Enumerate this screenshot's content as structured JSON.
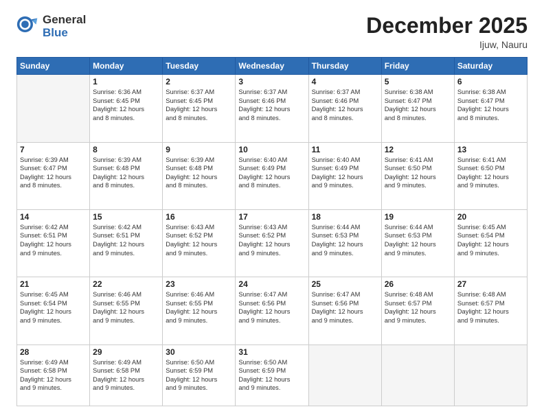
{
  "logo": {
    "general": "General",
    "blue": "Blue"
  },
  "title": "December 2025",
  "location": "Ijuw, Nauru",
  "weekdays": [
    "Sunday",
    "Monday",
    "Tuesday",
    "Wednesday",
    "Thursday",
    "Friday",
    "Saturday"
  ],
  "weeks": [
    [
      {
        "day": "",
        "info": ""
      },
      {
        "day": "1",
        "info": "Sunrise: 6:36 AM\nSunset: 6:45 PM\nDaylight: 12 hours\nand 8 minutes."
      },
      {
        "day": "2",
        "info": "Sunrise: 6:37 AM\nSunset: 6:45 PM\nDaylight: 12 hours\nand 8 minutes."
      },
      {
        "day": "3",
        "info": "Sunrise: 6:37 AM\nSunset: 6:46 PM\nDaylight: 12 hours\nand 8 minutes."
      },
      {
        "day": "4",
        "info": "Sunrise: 6:37 AM\nSunset: 6:46 PM\nDaylight: 12 hours\nand 8 minutes."
      },
      {
        "day": "5",
        "info": "Sunrise: 6:38 AM\nSunset: 6:47 PM\nDaylight: 12 hours\nand 8 minutes."
      },
      {
        "day": "6",
        "info": "Sunrise: 6:38 AM\nSunset: 6:47 PM\nDaylight: 12 hours\nand 8 minutes."
      }
    ],
    [
      {
        "day": "7",
        "info": "Sunrise: 6:39 AM\nSunset: 6:47 PM\nDaylight: 12 hours\nand 8 minutes."
      },
      {
        "day": "8",
        "info": "Sunrise: 6:39 AM\nSunset: 6:48 PM\nDaylight: 12 hours\nand 8 minutes."
      },
      {
        "day": "9",
        "info": "Sunrise: 6:39 AM\nSunset: 6:48 PM\nDaylight: 12 hours\nand 8 minutes."
      },
      {
        "day": "10",
        "info": "Sunrise: 6:40 AM\nSunset: 6:49 PM\nDaylight: 12 hours\nand 8 minutes."
      },
      {
        "day": "11",
        "info": "Sunrise: 6:40 AM\nSunset: 6:49 PM\nDaylight: 12 hours\nand 9 minutes."
      },
      {
        "day": "12",
        "info": "Sunrise: 6:41 AM\nSunset: 6:50 PM\nDaylight: 12 hours\nand 9 minutes."
      },
      {
        "day": "13",
        "info": "Sunrise: 6:41 AM\nSunset: 6:50 PM\nDaylight: 12 hours\nand 9 minutes."
      }
    ],
    [
      {
        "day": "14",
        "info": "Sunrise: 6:42 AM\nSunset: 6:51 PM\nDaylight: 12 hours\nand 9 minutes."
      },
      {
        "day": "15",
        "info": "Sunrise: 6:42 AM\nSunset: 6:51 PM\nDaylight: 12 hours\nand 9 minutes."
      },
      {
        "day": "16",
        "info": "Sunrise: 6:43 AM\nSunset: 6:52 PM\nDaylight: 12 hours\nand 9 minutes."
      },
      {
        "day": "17",
        "info": "Sunrise: 6:43 AM\nSunset: 6:52 PM\nDaylight: 12 hours\nand 9 minutes."
      },
      {
        "day": "18",
        "info": "Sunrise: 6:44 AM\nSunset: 6:53 PM\nDaylight: 12 hours\nand 9 minutes."
      },
      {
        "day": "19",
        "info": "Sunrise: 6:44 AM\nSunset: 6:53 PM\nDaylight: 12 hours\nand 9 minutes."
      },
      {
        "day": "20",
        "info": "Sunrise: 6:45 AM\nSunset: 6:54 PM\nDaylight: 12 hours\nand 9 minutes."
      }
    ],
    [
      {
        "day": "21",
        "info": "Sunrise: 6:45 AM\nSunset: 6:54 PM\nDaylight: 12 hours\nand 9 minutes."
      },
      {
        "day": "22",
        "info": "Sunrise: 6:46 AM\nSunset: 6:55 PM\nDaylight: 12 hours\nand 9 minutes."
      },
      {
        "day": "23",
        "info": "Sunrise: 6:46 AM\nSunset: 6:55 PM\nDaylight: 12 hours\nand 9 minutes."
      },
      {
        "day": "24",
        "info": "Sunrise: 6:47 AM\nSunset: 6:56 PM\nDaylight: 12 hours\nand 9 minutes."
      },
      {
        "day": "25",
        "info": "Sunrise: 6:47 AM\nSunset: 6:56 PM\nDaylight: 12 hours\nand 9 minutes."
      },
      {
        "day": "26",
        "info": "Sunrise: 6:48 AM\nSunset: 6:57 PM\nDaylight: 12 hours\nand 9 minutes."
      },
      {
        "day": "27",
        "info": "Sunrise: 6:48 AM\nSunset: 6:57 PM\nDaylight: 12 hours\nand 9 minutes."
      }
    ],
    [
      {
        "day": "28",
        "info": "Sunrise: 6:49 AM\nSunset: 6:58 PM\nDaylight: 12 hours\nand 9 minutes."
      },
      {
        "day": "29",
        "info": "Sunrise: 6:49 AM\nSunset: 6:58 PM\nDaylight: 12 hours\nand 9 minutes."
      },
      {
        "day": "30",
        "info": "Sunrise: 6:50 AM\nSunset: 6:59 PM\nDaylight: 12 hours\nand 9 minutes."
      },
      {
        "day": "31",
        "info": "Sunrise: 6:50 AM\nSunset: 6:59 PM\nDaylight: 12 hours\nand 9 minutes."
      },
      {
        "day": "",
        "info": ""
      },
      {
        "day": "",
        "info": ""
      },
      {
        "day": "",
        "info": ""
      }
    ]
  ]
}
